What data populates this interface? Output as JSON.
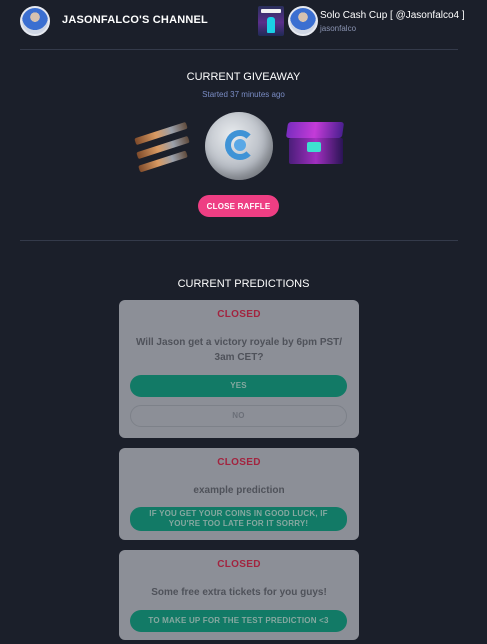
{
  "header": {
    "channel_title": "JASONFALCO'S CHANNEL",
    "stream_title": "Solo Cash Cup [ @Jasonfalco4 ]",
    "streamer": "jasonfalco"
  },
  "giveaway": {
    "title": "CURRENT GIVEAWAY",
    "started": "Started 37 minutes ago",
    "prizes": [
      "gun-prize",
      "stone-prize",
      "chest-prize"
    ],
    "close_button": "CLOSE RAFFLE"
  },
  "predictions": {
    "title": "CURRENT PREDICTIONS",
    "items": [
      {
        "status": "CLOSED",
        "question": "Will Jason get a victory royale by 6pm PST/ 3am CET?",
        "options": [
          "YES",
          "NO"
        ]
      },
      {
        "status": "CLOSED",
        "question": "example prediction",
        "options": [
          "IF YOU GET YOUR COINS IN GOOD LUCK, IF YOU'RE TOO LATE FOR IT SORRY!"
        ]
      },
      {
        "status": "CLOSED",
        "question": "Some free extra tickets for you guys!",
        "options": [
          "TO MAKE UP FOR THE TEST PREDICTION <3"
        ]
      }
    ]
  },
  "colors": {
    "background": "#1b1f2a",
    "accent_pink": "#ee3e83",
    "closed_red": "#a2243f",
    "option_green": "#127a66",
    "card_gray": "#8c8f97"
  }
}
